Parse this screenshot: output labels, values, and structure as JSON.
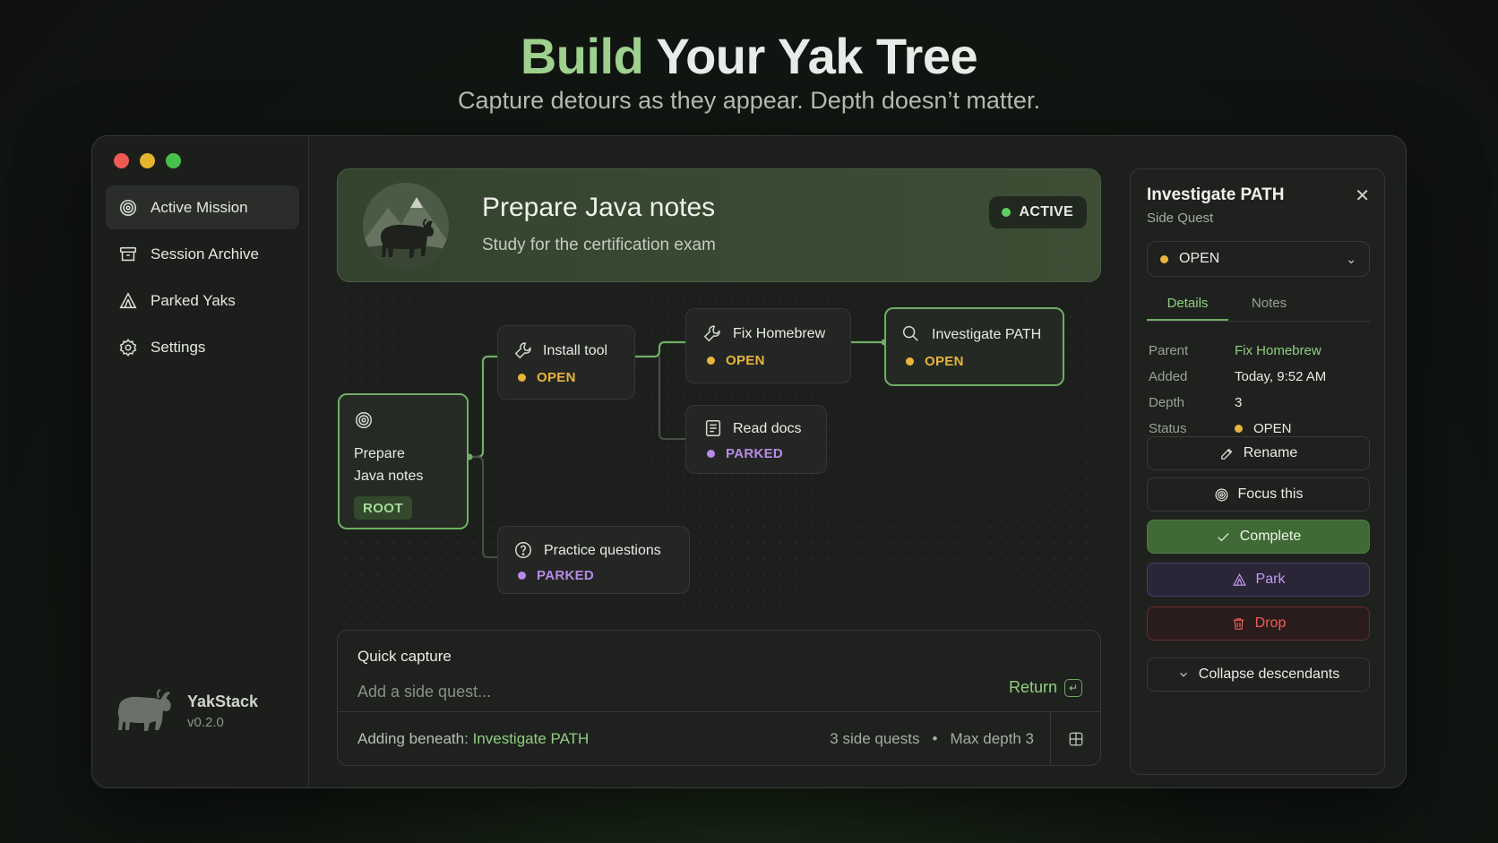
{
  "hero": {
    "title_accent": "Build",
    "title_rest": " Your Yak Tree",
    "subtitle": "Capture detours as they appear. Depth doesn’t matter."
  },
  "sidebar": {
    "items": [
      {
        "label": "Active Mission",
        "icon": "target-icon"
      },
      {
        "label": "Session Archive",
        "icon": "archive-icon"
      },
      {
        "label": "Parked Yaks",
        "icon": "tent-icon"
      },
      {
        "label": "Settings",
        "icon": "gear-icon"
      }
    ],
    "brand_name": "YakStack",
    "brand_version": "v0.2.0"
  },
  "mission": {
    "title": "Prepare Java notes",
    "subtitle": "Study for the certification exam",
    "status": "ACTIVE"
  },
  "tree": {
    "root": {
      "line1": "Prepare",
      "line2": "Java notes",
      "badge": "ROOT"
    },
    "nodes": [
      {
        "title": "Install tool",
        "status": "OPEN",
        "icon": "wrench-icon"
      },
      {
        "title": "Fix Homebrew",
        "status": "OPEN",
        "icon": "wrench-icon"
      },
      {
        "title": "Investigate PATH",
        "status": "OPEN",
        "icon": "search-icon"
      },
      {
        "title": "Read docs",
        "status": "PARKED",
        "icon": "document-icon"
      },
      {
        "title": "Practice questions",
        "status": "PARKED",
        "icon": "question-icon"
      }
    ]
  },
  "capture": {
    "heading": "Quick capture",
    "placeholder": "Add a side quest...",
    "return_label": "Return",
    "return_key": "↵",
    "beneath_label": "Adding beneath: ",
    "beneath_target": "Investigate PATH",
    "side_quests": "3 side quests",
    "separator": "•",
    "max_depth": "Max depth 3"
  },
  "panel": {
    "title": "Investigate PATH",
    "subtitle": "Side Quest",
    "close": "✕",
    "status_value": "OPEN",
    "tabs": [
      "Details",
      "Notes"
    ],
    "details": [
      {
        "key": "Parent",
        "value": "Fix Homebrew"
      },
      {
        "key": "Added",
        "value": "Today, 9:52 AM"
      },
      {
        "key": "Depth",
        "value": "3"
      },
      {
        "key": "Status",
        "value": "OPEN"
      }
    ],
    "buttons": {
      "rename": "Rename",
      "focus": "Focus this",
      "complete": "Complete",
      "park": "Park",
      "drop": "Drop",
      "collapse": "Collapse descendants"
    }
  },
  "colors": {
    "accent_green": "#8fcf7e",
    "open_yellow": "#e8b43c",
    "parked_purple": "#b78ae6",
    "drop_red": "#ef5d58"
  }
}
